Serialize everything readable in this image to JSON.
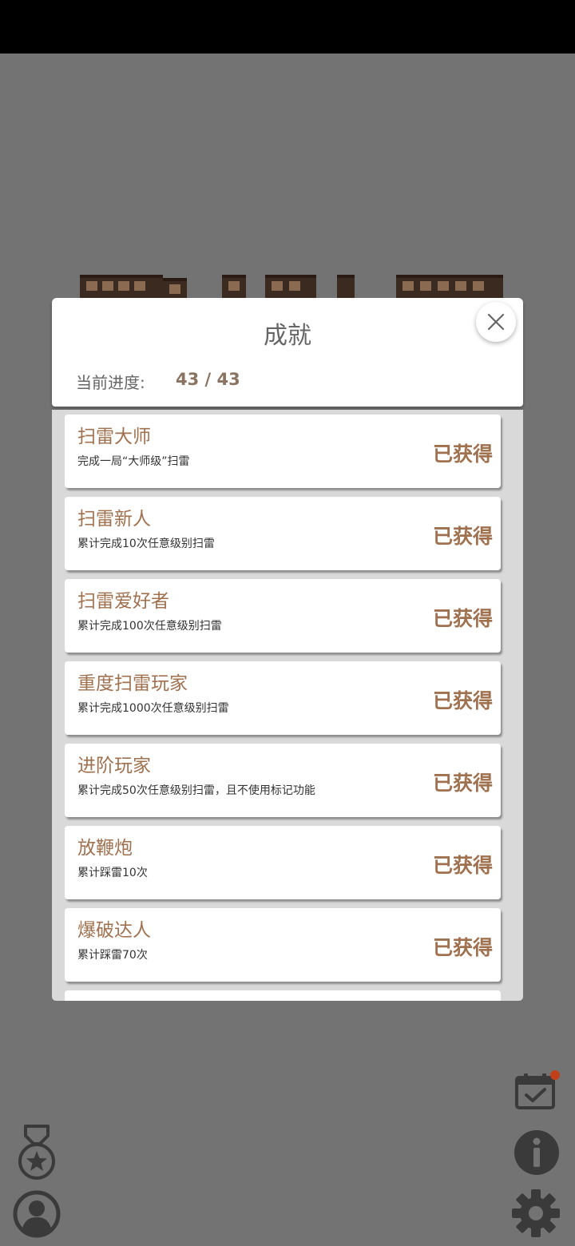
{
  "dialog": {
    "title": "成就",
    "progress_label": "当前进度:",
    "progress_value": "43 / 43"
  },
  "achievements": [
    {
      "title": "扫雷大师",
      "desc": "完成一局“大师级”扫雷",
      "status": "已获得"
    },
    {
      "title": "扫雷新人",
      "desc": "累计完成10次任意级别扫雷",
      "status": "已获得"
    },
    {
      "title": "扫雷爱好者",
      "desc": "累计完成100次任意级别扫雷",
      "status": "已获得"
    },
    {
      "title": "重度扫雷玩家",
      "desc": "累计完成1000次任意级别扫雷",
      "status": "已获得"
    },
    {
      "title": "进阶玩家",
      "desc": "累计完成50次任意级别扫雷，且不使用标记功能",
      "status": "已获得"
    },
    {
      "title": "放鞭炮",
      "desc": "累计踩雷10次",
      "status": "已获得"
    },
    {
      "title": "爆破达人",
      "desc": "累计踩雷70次",
      "status": "已获得"
    }
  ],
  "icons": {
    "close": "close-icon",
    "calendar": "calendar-check-icon",
    "info": "info-icon",
    "settings": "gear-icon",
    "medal": "medal-star-icon",
    "profile": "user-icon"
  },
  "colors": {
    "accent": "#a0714f",
    "overlay": "#737373",
    "notification": "#c0401a"
  }
}
